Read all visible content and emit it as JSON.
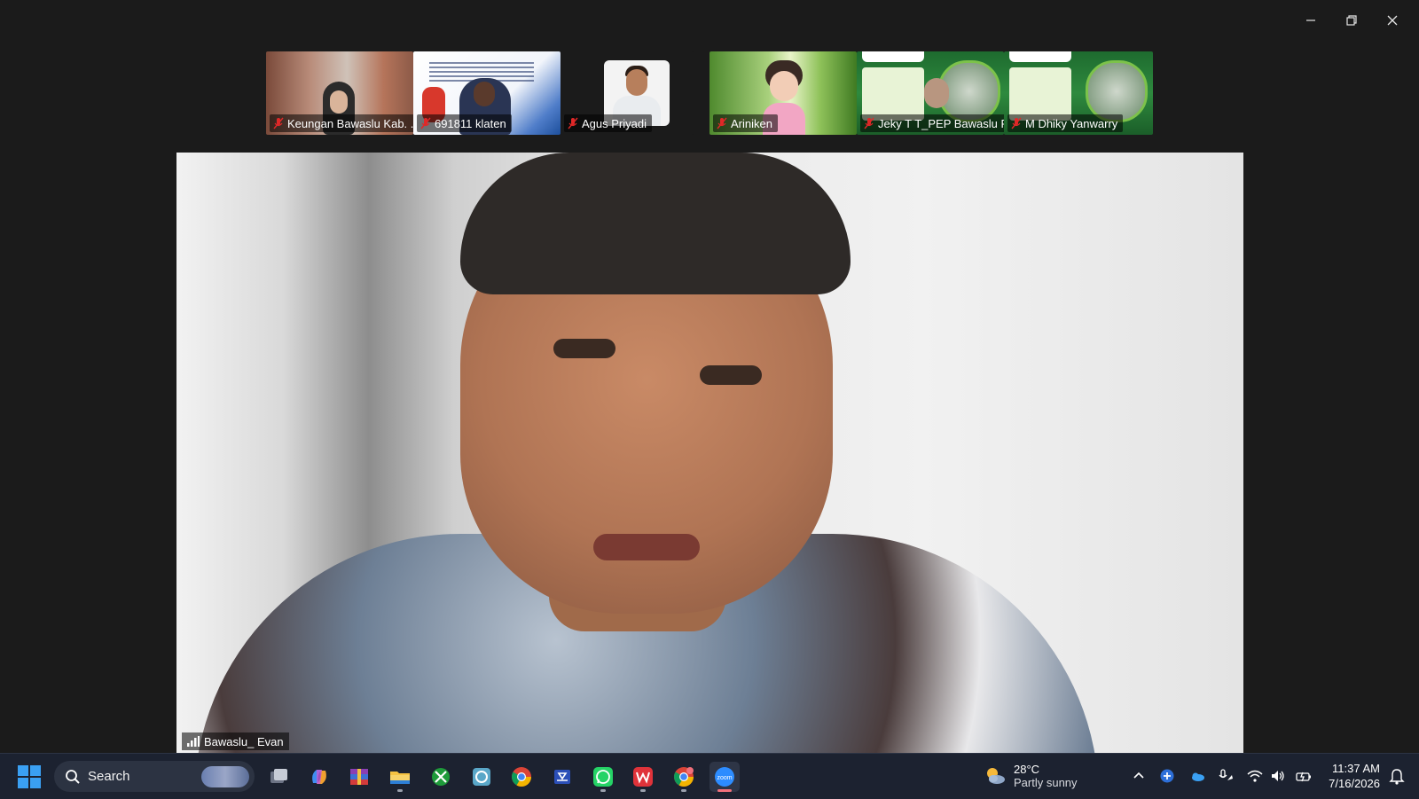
{
  "window": {
    "controls": [
      "minimize",
      "restore",
      "close"
    ]
  },
  "gallery": {
    "participants": [
      {
        "name": "Keungan Bawaslu Kab. ...",
        "muted": true
      },
      {
        "name": "691811 klaten",
        "muted": true
      },
      {
        "name": "Agus Priyadi",
        "muted": true
      },
      {
        "name": "Ariniken",
        "muted": true
      },
      {
        "name": "Jeky T T_PEP Bawaslu RI",
        "muted": true
      },
      {
        "name": "M Dhiky Yanwarry",
        "muted": true
      }
    ]
  },
  "speaker": {
    "name": "Bawaslu_ Evan"
  },
  "taskbar": {
    "search_label": "Search",
    "apps": [
      {
        "name": "task-view",
        "icon": "task-view-icon"
      },
      {
        "name": "copilot",
        "icon": "copilot-icon"
      },
      {
        "name": "winrar",
        "icon": "winrar-icon"
      },
      {
        "name": "file-explorer",
        "icon": "folder-icon"
      },
      {
        "name": "xbox",
        "icon": "xbox-icon"
      },
      {
        "name": "app-generic",
        "icon": "app-icon"
      },
      {
        "name": "chrome",
        "icon": "chrome-icon"
      },
      {
        "name": "pen-app",
        "icon": "pen-app-icon"
      },
      {
        "name": "whatsapp",
        "icon": "whatsapp-icon"
      },
      {
        "name": "wps-office",
        "icon": "wps-icon"
      },
      {
        "name": "chrome-profile",
        "icon": "chrome-icon"
      },
      {
        "name": "zoom",
        "icon": "zoom-icon"
      }
    ],
    "weather": {
      "temp": "28°C",
      "desc": "Partly sunny"
    },
    "clock": {
      "time": "11:37 AM",
      "date": "7/16/2026"
    }
  },
  "colors": {
    "window_bg": "#1b1b1b",
    "taskbar_bg": "#1c2230",
    "accent_zoom": "#2d8cff",
    "mute_red": "#e02828"
  }
}
